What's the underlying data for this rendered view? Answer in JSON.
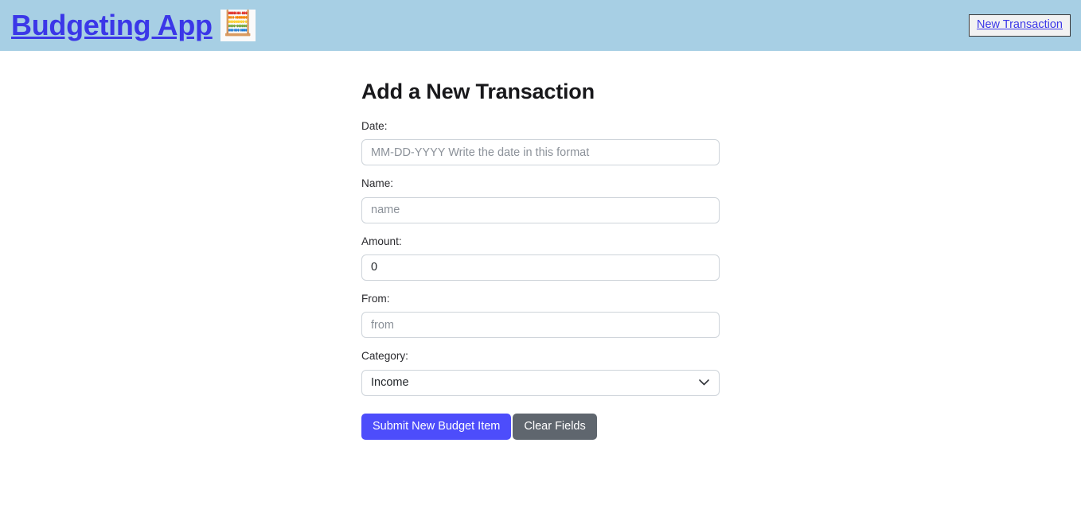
{
  "header": {
    "brand_label": "Budgeting App",
    "brand_emoji": "🧮",
    "nav_button_label": "New Transaction"
  },
  "main": {
    "title": "Add a New Transaction",
    "fields": [
      {
        "label": "Date:",
        "placeholder": "MM-DD-YYYY Write the date in this format",
        "value": ""
      },
      {
        "label": "Name:",
        "placeholder": "name",
        "value": ""
      },
      {
        "label": "Amount:",
        "placeholder": "",
        "value": "0"
      },
      {
        "label": "From:",
        "placeholder": "from",
        "value": ""
      }
    ],
    "category": {
      "label": "Category:",
      "selected": "Income",
      "options": [
        "Income"
      ]
    },
    "buttons": {
      "submit_label": "Submit New Budget Item",
      "clear_label": "Clear Fields"
    }
  },
  "colors": {
    "header_bg": "#a7cfe4",
    "link": "#3b37e8",
    "submit_bg": "#4d4dfb",
    "clear_bg": "#5f666e",
    "input_border": "#ced4da"
  }
}
